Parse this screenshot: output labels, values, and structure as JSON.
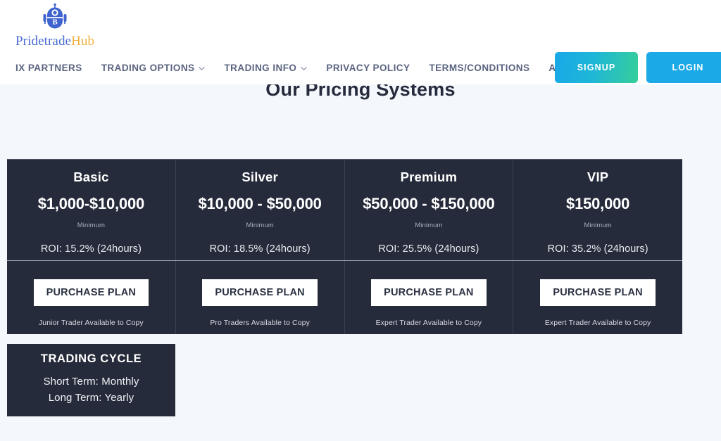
{
  "brand": {
    "logo_icon": "robot-bitcoin-icon",
    "name_primary": "Pridetrade",
    "name_accent": "Hub",
    "primary_color": "#4a6cd4",
    "accent_color": "#f3b23f"
  },
  "nav": {
    "items": [
      {
        "label": "IX PARTNERS",
        "has_dropdown": false
      },
      {
        "label": "TRADING OPTIONS",
        "has_dropdown": true
      },
      {
        "label": "TRADING INFO",
        "has_dropdown": true
      },
      {
        "label": "PRIVACY POLICY",
        "has_dropdown": false
      },
      {
        "label": "TERMS/CONDITIONS",
        "has_dropdown": false
      },
      {
        "label": "ABOUT US",
        "has_dropdown": false
      }
    ],
    "signup_label": "SIGNUP",
    "login_label": "LOGIN",
    "signup_gradient_from": "#18a8e8",
    "signup_gradient_to": "#36cf9a",
    "login_color": "#1ca9e8"
  },
  "page": {
    "title": "Our Pricing Systems",
    "background_color": "#f4f8fc",
    "card_background_color": "#262b3b"
  },
  "pricing": {
    "minimum_label": "Minimum",
    "purchase_label": "PURCHASE PLAN",
    "plans": [
      {
        "name": "Basic",
        "price": "$1,000-$10,000",
        "roi": "ROI: 15.2% (24hours)",
        "trader": "Junior Trader Available to Copy"
      },
      {
        "name": "Silver",
        "price": "$10,000 - $50,000",
        "roi": "ROI: 18.5% (24hours)",
        "trader": "Pro Traders Available to Copy"
      },
      {
        "name": "Premium",
        "price": "$50,000 - $150,000",
        "roi": "ROI: 25.5% (24hours)",
        "trader": "Expert Trader Available to Copy"
      },
      {
        "name": "VIP",
        "price": "$150,000",
        "roi": "ROI: 35.2% (24hours)",
        "trader": "Expert Trader Available to Copy"
      }
    ]
  },
  "trading_cycle": {
    "title": "TRADING CYCLE",
    "short_term": "Short Term: Monthly",
    "long_term": "Long Term: Yearly"
  }
}
